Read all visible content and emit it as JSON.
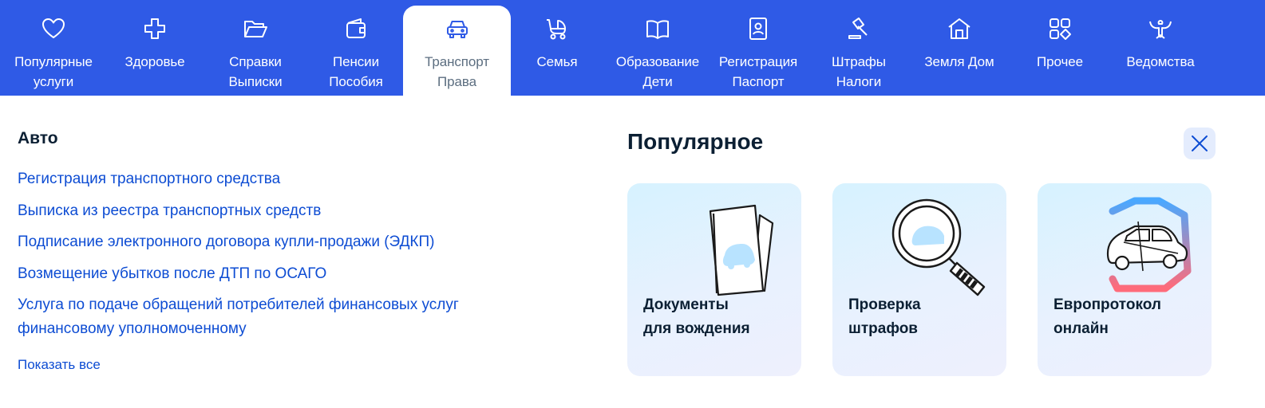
{
  "nav": {
    "items": [
      {
        "label": "Популярные\nуслуги",
        "icon": "heart-icon"
      },
      {
        "label": "Здоровье",
        "icon": "medical-cross-icon"
      },
      {
        "label": "Справки\nВыписки",
        "icon": "folder-icon"
      },
      {
        "label": "Пенсии\nПособия",
        "icon": "wallet-icon"
      },
      {
        "label": "Транспорт\nПрава",
        "icon": "car-icon",
        "active": true
      },
      {
        "label": "Семья",
        "icon": "stroller-icon"
      },
      {
        "label": "Образование\nДети",
        "icon": "book-icon"
      },
      {
        "label": "Регистрация\nПаспорт",
        "icon": "id-card-icon"
      },
      {
        "label": "Штрафы\nНалоги",
        "icon": "gavel-icon"
      },
      {
        "label": "Земля Дом",
        "icon": "house-icon"
      },
      {
        "label": "Прочее",
        "icon": "grid-icon"
      },
      {
        "label": "Ведомства",
        "icon": "emblem-icon"
      }
    ]
  },
  "section": {
    "title": "Авто",
    "links": [
      "Регистрация транспортного средства",
      "Выписка из реестра транспортных средств",
      "Подписание электронного договора купли-продажи (ЭДКП)",
      "Возмещение убытков после ДТП по ОСАГО",
      "Услуга по подаче обращений потребителей финансовых услуг финансовому уполномоченному"
    ],
    "show_all": "Показать все"
  },
  "popular": {
    "title": "Популярное",
    "close_icon": "close-icon",
    "cards": [
      {
        "title": "Документы\nдля вождения",
        "icon": "driving-documents-illustration"
      },
      {
        "title": "Проверка\nштрафов",
        "icon": "magnifier-car-illustration"
      },
      {
        "title": "Европротокол\nонлайн",
        "icon": "hexagon-car-illustration"
      }
    ]
  },
  "colors": {
    "nav_bg": "#2f5ae6",
    "link": "#0d4cd3",
    "text": "#0b1f33",
    "active_label": "#5c6e80",
    "close_bg": "#e4ecfd"
  }
}
